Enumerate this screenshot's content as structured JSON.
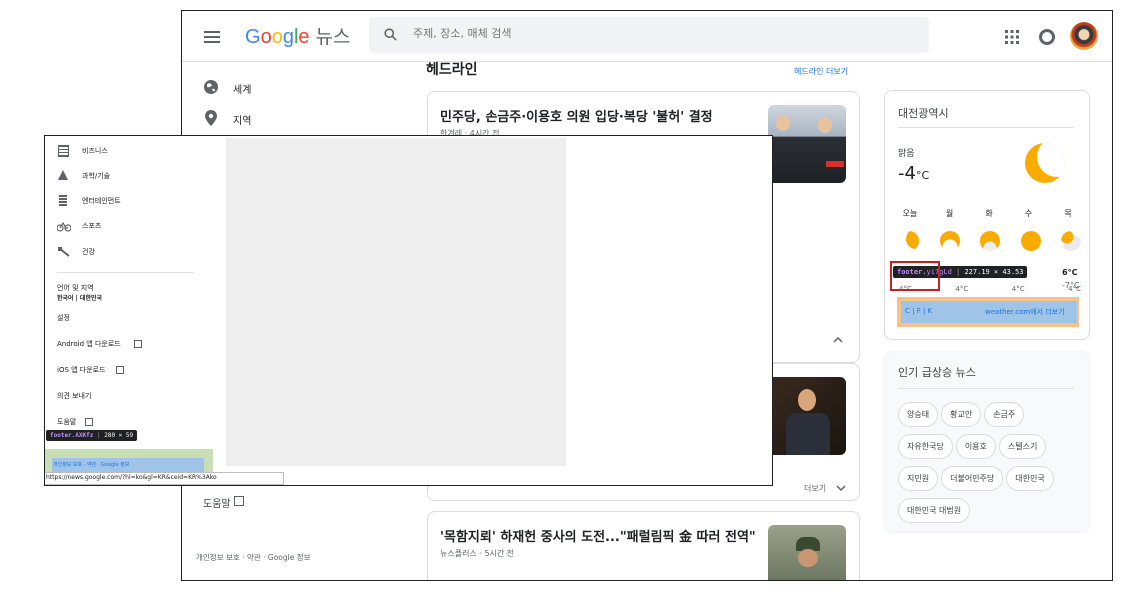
{
  "header": {
    "logo_google": "Google",
    "logo_news": "뉴스",
    "search_placeholder": "주제, 장소, 매체 검색"
  },
  "sidebar": {
    "items": [
      {
        "label": "세계",
        "icon": "globe-icon"
      },
      {
        "label": "지역",
        "icon": "location-pin-icon"
      }
    ],
    "help": "도움말",
    "footer": "개인정보 보호 · 약관 · Google 정보"
  },
  "headlines": {
    "title": "헤드라인",
    "more_link": "헤드라인 더보기",
    "articles": [
      {
        "title": "민주당, 손금주·이용호 의원 입당·복당 '불허' 결정",
        "source": "한겨레",
        "time": "4시간 전"
      },
      {
        "title": "'목함지뢰' 하재헌 중사의 도전...\"패럴림픽 金 따러 전역\"",
        "source": "뉴스플러스",
        "time": "5시간 전"
      }
    ],
    "more_label": "더보기"
  },
  "weather": {
    "location": "대전광역시",
    "condition": "맑음",
    "temperature": "-4",
    "unit": "°C",
    "days": [
      "오늘",
      "월",
      "화",
      "수",
      "목"
    ],
    "day_temps": [
      "4°C",
      "4°C",
      "4°C",
      "4°C"
    ],
    "last_high": "6°C",
    "last_low": "-7°C",
    "unit_options": "C | F | K",
    "source_link": "weather.com에서 더보기"
  },
  "inspector": {
    "weather_tooltip_class": "footer.",
    "weather_tooltip_rest": "yi7gLd",
    "weather_tooltip_size": "227.19 × 43.53",
    "sidebar_tooltip_class": "footer.AXKfz",
    "sidebar_tooltip_size": "280 × 59"
  },
  "trending": {
    "title": "인기 급상승 뉴스",
    "chips": [
      "양승태",
      "황교안",
      "손금주",
      "자유한국당",
      "이용호",
      "스텔스기",
      "지민원",
      "더불어민주당",
      "대한민국",
      "대한민국 대법원"
    ]
  },
  "overlay": {
    "nav_items": [
      {
        "label": "비즈니스",
        "icon": "building-icon"
      },
      {
        "label": "과학/기술",
        "icon": "flask-icon"
      },
      {
        "label": "엔터테인먼트",
        "icon": "film-icon"
      },
      {
        "label": "스포츠",
        "icon": "bicycle-icon"
      },
      {
        "label": "건강",
        "icon": "health-icon"
      }
    ],
    "language_label": "언어 및 지역",
    "language_value": "한국어 | 대한민국",
    "settings": "설정",
    "android": "Android 앱 다운로드",
    "ios": "iOS 앱 다운로드",
    "feedback": "의견 보내기",
    "help": "도움말",
    "footer": "개인정보 보호 · 약관 · Google 정보",
    "status_url": "https://news.google.com/?hl=ko&gl=KR&ceid=KR%3Ako"
  }
}
